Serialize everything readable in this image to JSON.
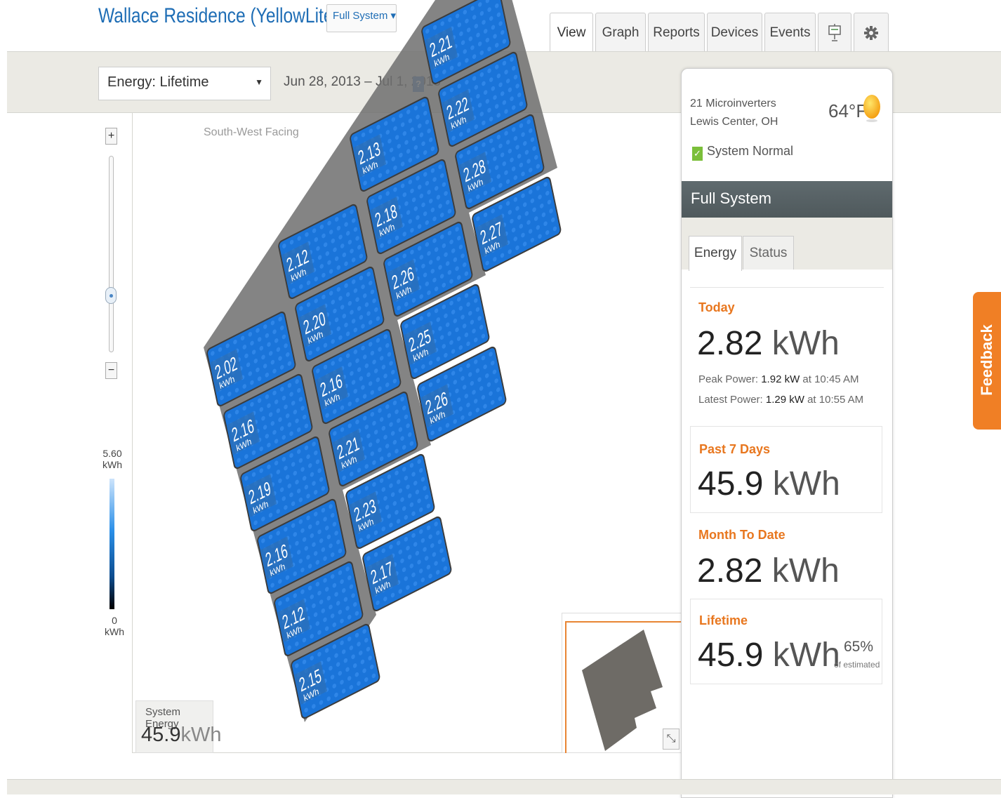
{
  "header": {
    "title": "Wallace Residence (YellowLite)",
    "system_dropdown": "Full System",
    "dropdown_caret": "▾"
  },
  "tabs": [
    {
      "label": "View"
    },
    {
      "label": "Graph"
    },
    {
      "label": "Reports"
    },
    {
      "label": "Devices"
    },
    {
      "label": "Events"
    },
    {
      "label": "",
      "icon": "presentation-icon"
    },
    {
      "label": "",
      "icon": "gear-icon"
    }
  ],
  "toolbar": {
    "range_select": "Energy: Lifetime",
    "date_range": "Jun 28, 2013 – Jul 1, 2013",
    "help_label": "?"
  },
  "map": {
    "facing_label": "South-West Facing",
    "zoom_in": "+",
    "zoom_out": "−",
    "legend_max": "5.60",
    "legend_max_unit": "kWh",
    "legend_min": "0",
    "legend_min_unit": "kWh",
    "panel_unit": "kWh",
    "panels": [
      {
        "col": 0,
        "row": 0,
        "value": "2.02"
      },
      {
        "col": 0,
        "row": 1,
        "value": "2.16"
      },
      {
        "col": 0,
        "row": 2,
        "value": "2.19"
      },
      {
        "col": 0,
        "row": 3,
        "value": "2.16"
      },
      {
        "col": 0,
        "row": 4,
        "value": "2.12"
      },
      {
        "col": 0,
        "row": 5,
        "value": "2.15"
      },
      {
        "col": 1,
        "row": -1,
        "value": "2.12"
      },
      {
        "col": 1,
        "row": 0,
        "value": "2.20"
      },
      {
        "col": 1,
        "row": 1,
        "value": "2.16"
      },
      {
        "col": 1,
        "row": 2,
        "value": "2.21"
      },
      {
        "col": 1,
        "row": 3,
        "value": "2.23"
      },
      {
        "col": 1,
        "row": 4,
        "value": "2.17"
      },
      {
        "col": 2,
        "row": -2,
        "value": "2.13"
      },
      {
        "col": 2,
        "row": -1,
        "value": "2.18"
      },
      {
        "col": 2,
        "row": 0,
        "value": "2.26"
      },
      {
        "col": 2,
        "row": 1,
        "value": "2.25"
      },
      {
        "col": 2,
        "row": 2,
        "value": "2.26"
      },
      {
        "col": 3,
        "row": -3,
        "value": "2.21"
      },
      {
        "col": 3,
        "row": -2,
        "value": "2.22"
      },
      {
        "col": 3,
        "row": -1,
        "value": "2.28"
      },
      {
        "col": 3,
        "row": 0,
        "value": "2.27"
      }
    ],
    "system_energy_label": "System Energy",
    "system_energy_value": "45.9",
    "system_energy_unit": "kWh",
    "minimap_button": "⤡"
  },
  "side_panel": {
    "microinverters": "21 Microinverters",
    "location": "Lewis Center, OH",
    "temperature": "64°F",
    "status_check": "✓",
    "status": "System Normal",
    "system_name": "Full System",
    "tab_energy": "Energy",
    "tab_status": "Status",
    "today_label": "Today",
    "today_value": "2.82",
    "today_unit": "kWh",
    "peak_power_label": "Peak Power: ",
    "peak_power_value": "1.92 kW",
    "peak_power_time": " at 10:45 AM",
    "latest_power_label": "Latest Power: ",
    "latest_power_value": "1.29 kW",
    "latest_power_time": " at 10:55 AM",
    "past7_label": "Past 7 Days",
    "past7_value": "45.9",
    "past7_unit": "kWh",
    "mtd_label": "Month To Date",
    "mtd_value": "2.82",
    "mtd_unit": "kWh",
    "lifetime_label": "Lifetime",
    "lifetime_value": "45.9",
    "lifetime_unit": "kWh",
    "lifetime_pct": "65%",
    "lifetime_pct_label": "of estimated"
  },
  "feedback_label": "Feedback",
  "colors": {
    "panel_blue": "#1a74d9",
    "accent_orange": "#e8771f",
    "title_blue": "#1e6db5"
  }
}
